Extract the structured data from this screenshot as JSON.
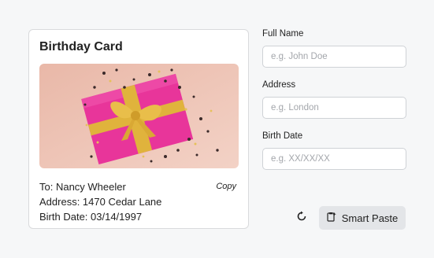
{
  "card": {
    "title": "Birthday Card",
    "to_line": "To: Nancy Wheeler",
    "address_line": "Address: 1470 Cedar Lane",
    "birth_line": "Birth Date: 03/14/1997",
    "copy_label": "Copy",
    "image_icon": "gift-box-photo"
  },
  "form": {
    "full_name": {
      "label": "Full Name",
      "placeholder": "e.g. John Doe",
      "value": ""
    },
    "address": {
      "label": "Address",
      "placeholder": "e.g. London",
      "value": ""
    },
    "birth_date": {
      "label": "Birth Date",
      "placeholder": "e.g. XX/XX/XX",
      "value": ""
    }
  },
  "actions": {
    "reset_icon": "refresh-icon",
    "smart_paste_label": "Smart Paste",
    "smart_paste_icon": "paste-icon"
  },
  "colors": {
    "background": "#f6f7f8",
    "card": "#ffffff",
    "button": "#e3e5e8",
    "gift": "#e8359a",
    "ribbon": "#e0b33c"
  }
}
